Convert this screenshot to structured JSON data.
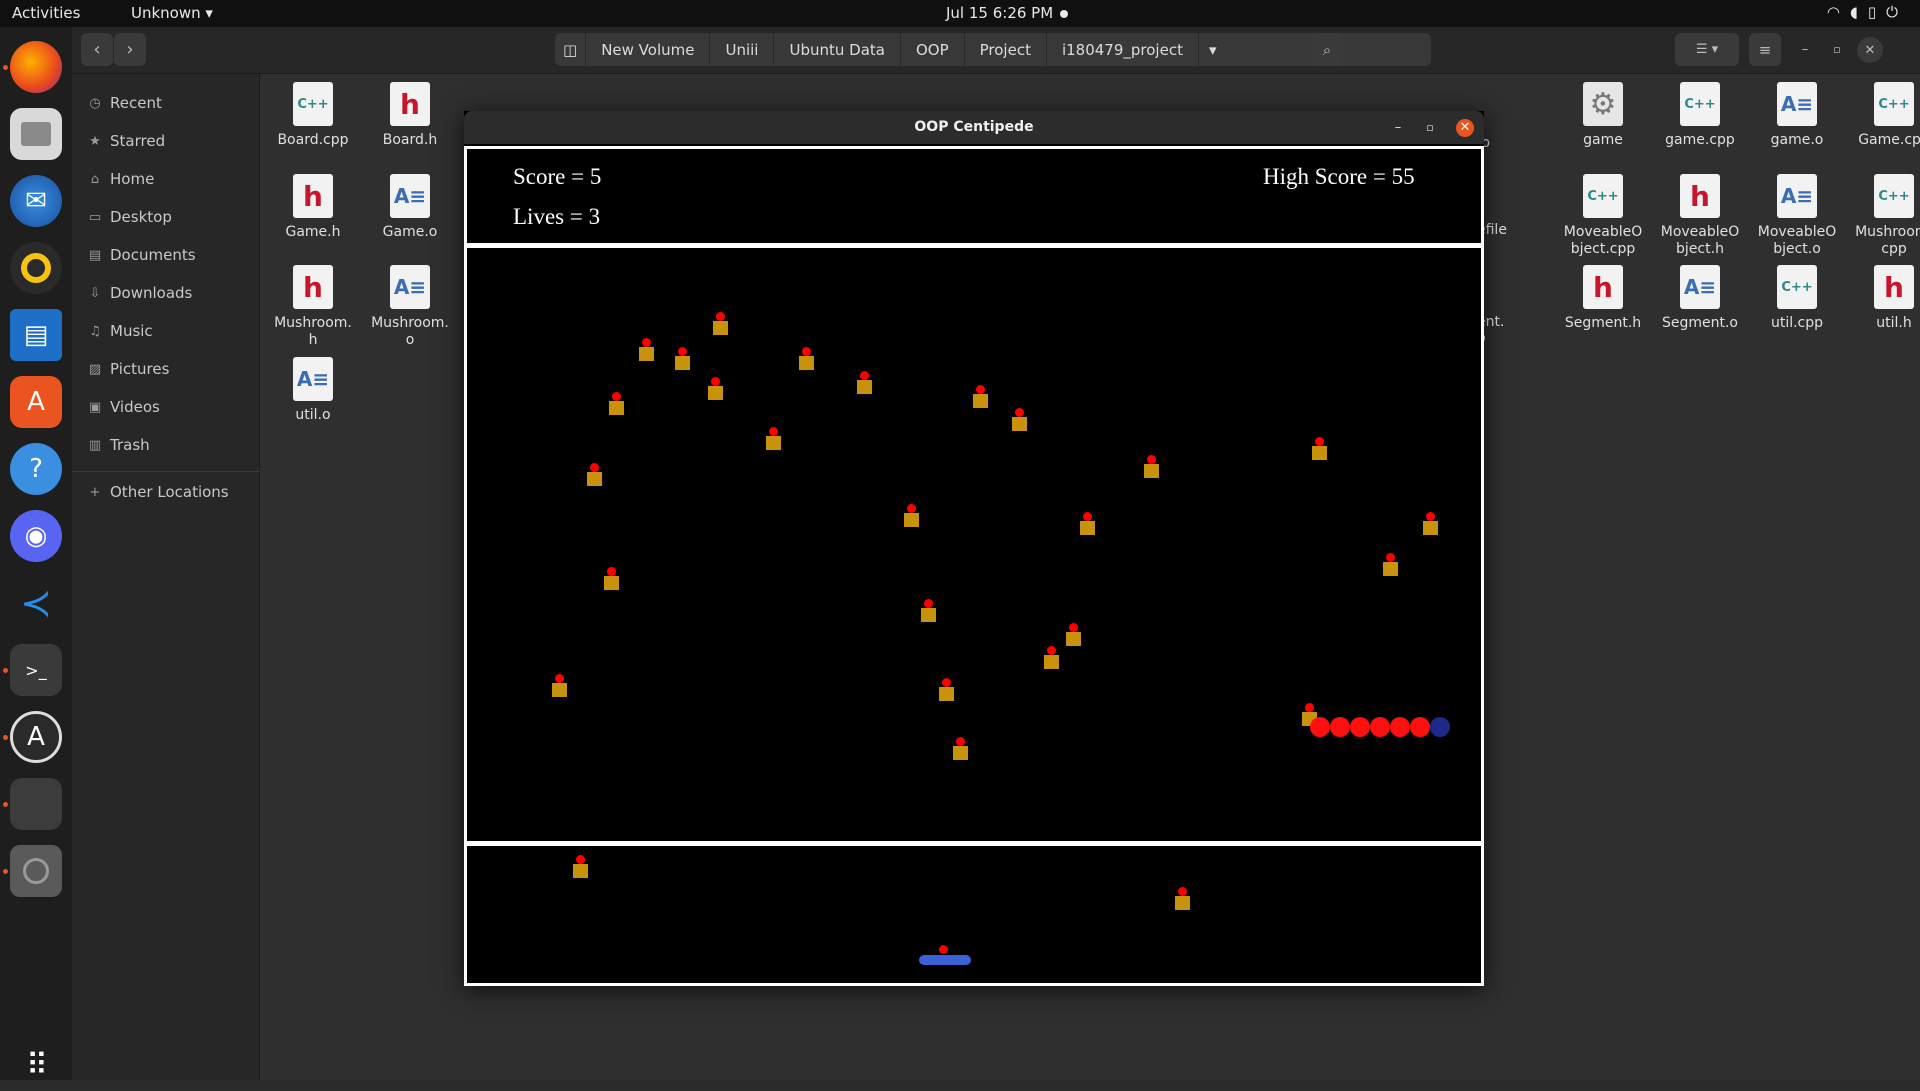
{
  "topbar": {
    "activities": "Activities",
    "app_menu": "Unknown ▾",
    "clock": "Jul 15   6:26 PM",
    "tray_icons": [
      "wifi-icon",
      "volume-icon",
      "battery-icon",
      "power-menu-icon"
    ]
  },
  "dock": {
    "items": [
      "firefox-icon",
      "files-icon",
      "thunderbird-icon",
      "rhythmbox-icon",
      "libreoffice-writer-icon",
      "app-center-icon",
      "help-icon",
      "discord-icon",
      "vscode-icon",
      "terminal-icon",
      "software-updater-icon",
      "running-app-icon",
      "disc-icon",
      "app-grid-icon"
    ]
  },
  "file_manager": {
    "path": [
      "New Volume",
      "Uniii",
      "Ubuntu Data",
      "OOP",
      "Project",
      "i180479_project"
    ],
    "sidebar": [
      {
        "label": "Recent",
        "icon": "clock-icon"
      },
      {
        "label": "Starred",
        "icon": "star-icon"
      },
      {
        "label": "Home",
        "icon": "home-icon"
      },
      {
        "label": "Desktop",
        "icon": "desktop-icon"
      },
      {
        "label": "Documents",
        "icon": "document-icon"
      },
      {
        "label": "Downloads",
        "icon": "download-icon"
      },
      {
        "label": "Music",
        "icon": "music-icon"
      },
      {
        "label": "Pictures",
        "icon": "picture-icon"
      },
      {
        "label": "Videos",
        "icon": "video-icon"
      },
      {
        "label": "Trash",
        "icon": "trash-icon"
      },
      {
        "label": "Other Locations",
        "icon": "plus-icon"
      }
    ],
    "files_left": [
      {
        "name": "Board.cpp",
        "kind": "cpp"
      },
      {
        "name": "Board.h",
        "kind": "h"
      },
      {
        "name": "Game.h",
        "kind": "h"
      },
      {
        "name": "Game.o",
        "kind": "o"
      },
      {
        "name": "Mushroom.\nh",
        "kind": "h"
      },
      {
        "name": "Mushroom.\no",
        "kind": "o"
      },
      {
        "name": "util.o",
        "kind": "o"
      }
    ],
    "files_right": [
      {
        "name": "game",
        "kind": "exe"
      },
      {
        "name": "game.cpp",
        "kind": "cpp"
      },
      {
        "name": "game.o",
        "kind": "o"
      },
      {
        "name": "Game.cpp",
        "kind": "cpp"
      },
      {
        "name": "MoveableO\nbject.cpp",
        "kind": "cpp"
      },
      {
        "name": "MoveableO\nbject.h",
        "kind": "h"
      },
      {
        "name": "MoveableO\nbject.o",
        "kind": "o"
      },
      {
        "name": "Mushroom.\ncpp",
        "kind": "cpp"
      },
      {
        "name": "Segment.h",
        "kind": "h"
      },
      {
        "name": "Segment.o",
        "kind": "o"
      },
      {
        "name": "util.cpp",
        "kind": "cpp"
      },
      {
        "name": "util.h",
        "kind": "h"
      }
    ],
    "partial_labels": [
      ".o",
      "efile",
      "ent.\np"
    ]
  },
  "game": {
    "title": "OOP Centipede",
    "score_label": "Score = 5",
    "lives_label": "Lives = 3",
    "high_score_label": "High Score =  55",
    "centipede_segments": 7
  },
  "colors": {
    "accent": "#e95420",
    "mushroom": "#c8920c",
    "mushroom_cap": "#ff0000",
    "centipede_body": "#ff1010",
    "centipede_head": "#1e2a8a",
    "player": "#3a62d8"
  }
}
